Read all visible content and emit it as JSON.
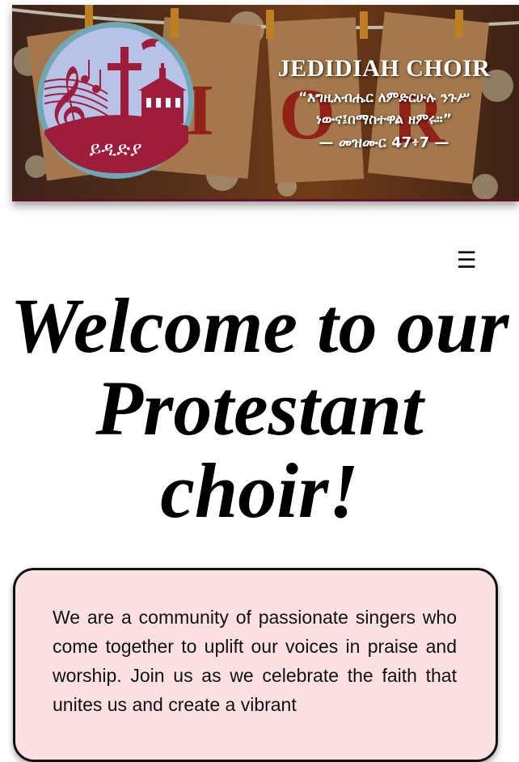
{
  "header": {
    "logo_text": "ይዲድያ",
    "choir_title": "JEDIDIAH CHOIR",
    "verse_line1": "“እግዚአብሔር ለምድርሁሉ ንጉሥ",
    "verse_line2": "ነውና፤በማስተዋል ዘምሩ።”",
    "verse_ref": "— መዝሙር 47፥7 —",
    "banner_letters": [
      "I",
      "O",
      "R"
    ]
  },
  "nav": {
    "menu_icon": "☰"
  },
  "hero": {
    "line1": "Welcome to our",
    "line2": "Protestant",
    "line3": "choir!"
  },
  "about": {
    "text": "We are a community of passionate singers who come together to uplift our voices in praise and worship. Join us as we celebrate the faith that unites us and create a vibrant"
  },
  "colors": {
    "banner_border": "#6a0e22",
    "logo_ring": "#6fa7b4",
    "logo_sky": "#b8c1e8",
    "logo_burgundy": "#9e1c3c",
    "card_background": "#fde0e1"
  }
}
